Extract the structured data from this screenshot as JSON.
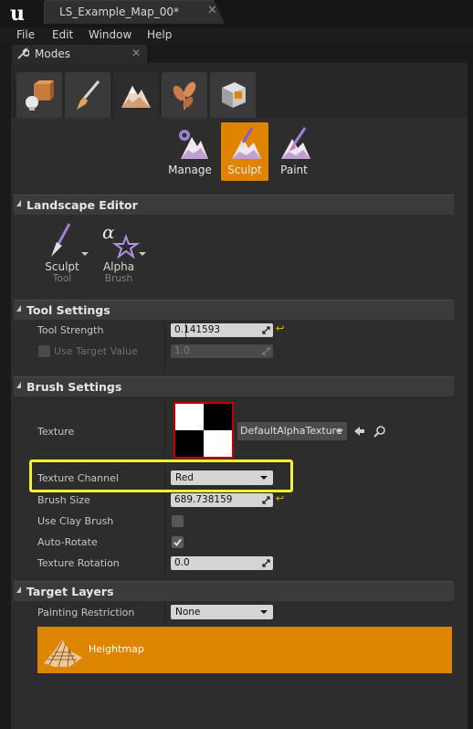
{
  "titlebar": {
    "document_tab": "LS_Example_Map_00*",
    "close": "✕"
  },
  "menu": [
    "File",
    "Edit",
    "Window",
    "Help"
  ],
  "panel": {
    "tab_label": "Modes",
    "close": "✕"
  },
  "modes": [
    "place-mode",
    "paint-mode",
    "landscape-mode",
    "foliage-mode",
    "geometry-mode"
  ],
  "tool_modes": [
    {
      "label": "Manage"
    },
    {
      "label": "Sculpt"
    },
    {
      "label": "Paint"
    }
  ],
  "landscape_editor": {
    "title": "Landscape Editor",
    "tool": {
      "name": "Sculpt",
      "sub": "Tool"
    },
    "brush": {
      "name": "Alpha",
      "sub": "Brush"
    }
  },
  "tool_settings": {
    "title": "Tool Settings",
    "strength_label": "Tool Strength",
    "strength_value": "0.141593",
    "strength_fraction": 0.14,
    "use_target_label": "Use Target Value",
    "use_target_value": "1.0"
  },
  "brush_settings": {
    "title": "Brush Settings",
    "texture_label": "Texture",
    "texture_asset": "DefaultAlphaTexture",
    "channel_label": "Texture Channel",
    "channel_value": "Red",
    "size_label": "Brush Size",
    "size_value": "689.738159",
    "clay_label": "Use Clay Brush",
    "clay_checked": false,
    "autorotate_label": "Auto-Rotate",
    "autorotate_checked": true,
    "rotation_label": "Texture Rotation",
    "rotation_value": "0.0"
  },
  "target_layers": {
    "title": "Target Layers",
    "restriction_label": "Painting Restriction",
    "restriction_value": "None",
    "layer_name": "Heightmap"
  },
  "colors": {
    "accent": "#e08400",
    "highlight": "#f5f030",
    "panel": "#2d2d2d"
  }
}
